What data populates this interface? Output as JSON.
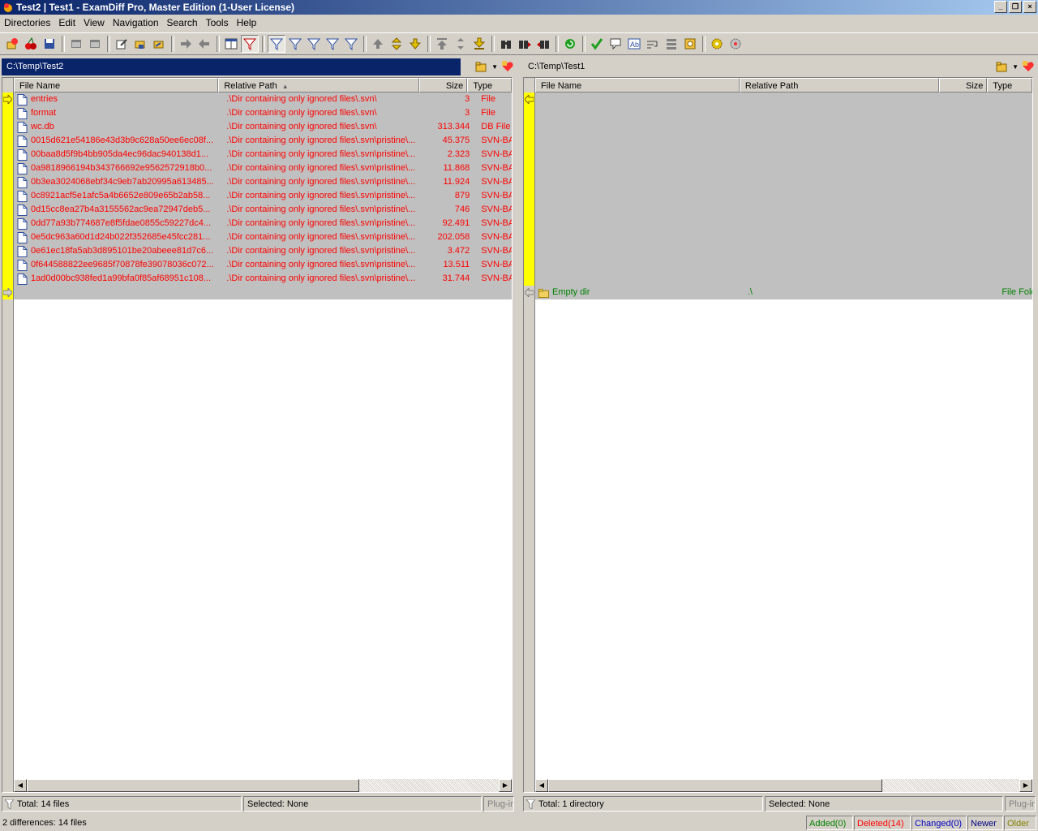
{
  "window": {
    "title": "Test2  |  Test1 - ExamDiff Pro, Master Edition (1-User License)",
    "buttons": [
      "_",
      "❐",
      "×"
    ]
  },
  "menu": [
    "Directories",
    "Edit",
    "View",
    "Navigation",
    "Search",
    "Tools",
    "Help"
  ],
  "left_pane": {
    "path": "C:\\Temp\\Test2",
    "columns": {
      "name": "File Name",
      "path": "Relative Path",
      "size": "Size",
      "type": "Type"
    },
    "rows": [
      {
        "name": "entries",
        "path": ".\\Dir containing only ignored files\\.svn\\",
        "size": "3",
        "type": "File"
      },
      {
        "name": "format",
        "path": ".\\Dir containing only ignored files\\.svn\\",
        "size": "3",
        "type": "File"
      },
      {
        "name": "wc.db",
        "path": ".\\Dir containing only ignored files\\.svn\\",
        "size": "313.344",
        "type": "DB File"
      },
      {
        "name": "0015d621e54186e43d3b9c628a50ee6ec08f...",
        "path": ".\\Dir containing only ignored files\\.svn\\pristine\\...",
        "size": "45.375",
        "type": "SVN-BAS"
      },
      {
        "name": "00baa8d5f9b4bb905da4ec96dac940138d1...",
        "path": ".\\Dir containing only ignored files\\.svn\\pristine\\...",
        "size": "2.323",
        "type": "SVN-BAS"
      },
      {
        "name": "0a9818966194b343766692e9562572918b0...",
        "path": ".\\Dir containing only ignored files\\.svn\\pristine\\...",
        "size": "11.868",
        "type": "SVN-BAS"
      },
      {
        "name": "0b3ea3024068ebf34c9eb7ab20995a613485...",
        "path": ".\\Dir containing only ignored files\\.svn\\pristine\\...",
        "size": "11.924",
        "type": "SVN-BAS"
      },
      {
        "name": "0c8921acf5e1afc5a4b6652e809e65b2ab58...",
        "path": ".\\Dir containing only ignored files\\.svn\\pristine\\...",
        "size": "879",
        "type": "SVN-BAS"
      },
      {
        "name": "0d15cc8ea27b4a3155562ac9ea72947deb5...",
        "path": ".\\Dir containing only ignored files\\.svn\\pristine\\...",
        "size": "746",
        "type": "SVN-BAS"
      },
      {
        "name": "0dd77a93b774687e8f5fdae0855c59227dc4...",
        "path": ".\\Dir containing only ignored files\\.svn\\pristine\\...",
        "size": "92.491",
        "type": "SVN-BAS"
      },
      {
        "name": "0e5dc963a60d1d24b022f352685e45fcc281...",
        "path": ".\\Dir containing only ignored files\\.svn\\pristine\\...",
        "size": "202.058",
        "type": "SVN-BAS"
      },
      {
        "name": "0e61ec18fa5ab3d895101be20abeee81d7c6...",
        "path": ".\\Dir containing only ignored files\\.svn\\pristine\\...",
        "size": "3.472",
        "type": "SVN-BAS"
      },
      {
        "name": "0f644588822ee9685f70878fe39078036c072...",
        "path": ".\\Dir containing only ignored files\\.svn\\pristine\\...",
        "size": "13.511",
        "type": "SVN-BAS"
      },
      {
        "name": "1ad0d00bc938fed1a99bfa0f85af68951c108...",
        "path": ".\\Dir containing only ignored files\\.svn\\pristine\\...",
        "size": "31.744",
        "type": "SVN-BAS"
      }
    ],
    "status": {
      "total": "Total: 14 files",
      "selected": "Selected: None",
      "plugin": "Plug-in"
    }
  },
  "right_pane": {
    "path": "C:\\Temp\\Test1",
    "columns": {
      "name": "File Name",
      "path": "Relative Path",
      "size": "Size",
      "type": "Type"
    },
    "rows": [
      {
        "name": "Empty dir",
        "path": ".\\",
        "size": "",
        "type": "File Folder"
      }
    ],
    "status": {
      "total": "Total: 1 directory",
      "selected": "Selected: None",
      "plugin": "Plug-in"
    }
  },
  "bottom_status": {
    "summary": "2 differences: 14 files",
    "added": "Added(0)",
    "deleted": "Deleted(14)",
    "changed": "Changed(0)",
    "newer": "Newer",
    "older": "Older"
  },
  "colors": {
    "deleted": "#ff0000",
    "added": "#008000",
    "changed": "#0000c0",
    "diff_marker": "#ffff00",
    "active_path": "#0a246a"
  }
}
